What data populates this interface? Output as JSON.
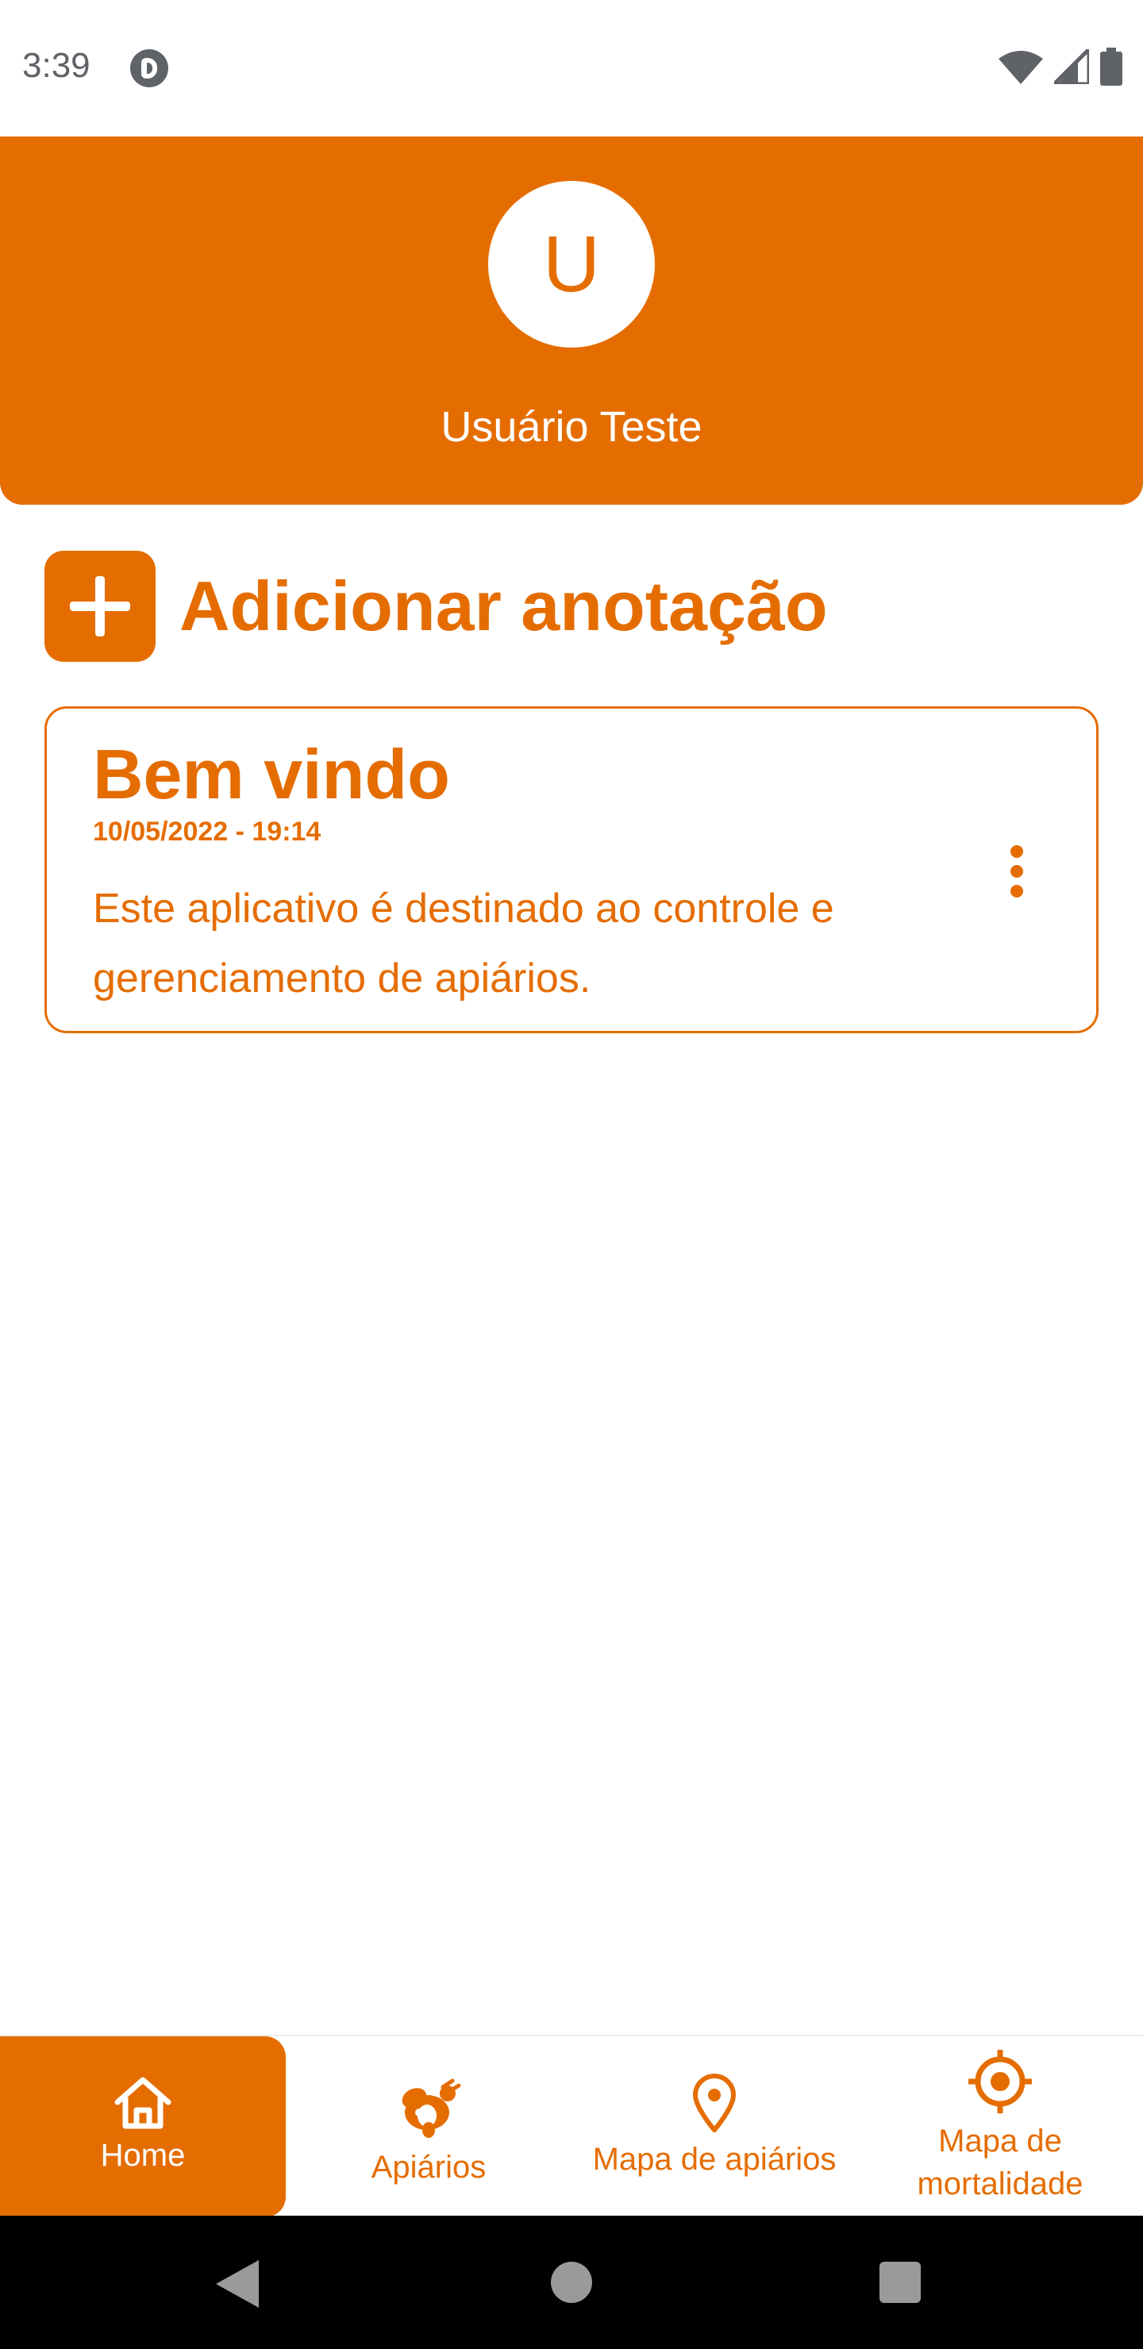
{
  "status_bar": {
    "time": "3:39"
  },
  "header": {
    "avatar_letter": "U",
    "user_name": "Usuário Teste"
  },
  "add_note": {
    "label": "Adicionar anotação"
  },
  "notes": [
    {
      "title": "Bem vindo",
      "date": "10/05/2022 - 19:14",
      "body": "Este aplicativo é destinado ao controle e gerenciamento de apiários."
    }
  ],
  "bottom_nav": {
    "items": [
      {
        "label": "Home",
        "icon": "home-icon",
        "active": true
      },
      {
        "label": "Apiários",
        "icon": "bee-icon",
        "active": false
      },
      {
        "label": "Mapa de apiários",
        "icon": "map-pin-icon",
        "active": false
      },
      {
        "label": "Mapa de mortalidade",
        "icon": "crosshair-icon",
        "active": false
      }
    ]
  },
  "colors": {
    "primary": "#e56d00",
    "background": "#ffffff",
    "status_gray": "#5f6368"
  }
}
